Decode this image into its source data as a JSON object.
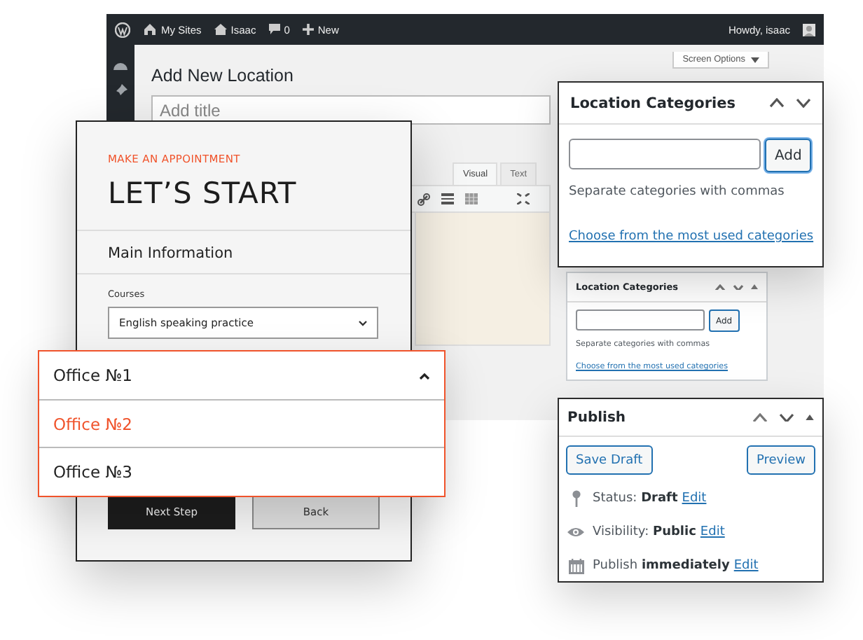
{
  "admin": {
    "toolbar": {
      "sites": "My Sites",
      "user_site": "Isaac",
      "comments": "0",
      "new": "New",
      "greeting": "Howdy, isaac"
    },
    "screen_options": "Screen Options",
    "page_title": "Add New Location",
    "title_field": {
      "placeholder": "Add title"
    },
    "editor_tabs": [
      {
        "label": "Visual",
        "selected": true
      },
      {
        "label": "Text",
        "selected": false
      }
    ],
    "side_box": {
      "title": "Location Categories",
      "button": "Add",
      "hint": "Separate categories with commas",
      "link": "Choose from the most used categories"
    }
  },
  "categories_panel": {
    "title": "Location Categories",
    "button": "Add",
    "hint": "Separate categories with commas",
    "link": "Choose from the most used categories"
  },
  "form": {
    "eyebrow": "MAKE AN APPOINTMENT",
    "title": "LET’S START",
    "section": "Main Information",
    "field_label": "Courses",
    "field_value": "English speaking practice",
    "buttons": [
      {
        "label": "Next Step",
        "kind": "primary"
      },
      {
        "label": "Back",
        "kind": "secondary"
      }
    ]
  },
  "office_dropdown": {
    "value": "Office №1",
    "expanded": true,
    "options": [
      {
        "label": "Office №2",
        "selected": true
      },
      {
        "label": "Office №3",
        "selected": false
      }
    ]
  },
  "publish": {
    "title": "Publish",
    "buttons": [
      "Save Draft",
      "Preview"
    ],
    "rows": [
      {
        "kind": "status",
        "text": "Status: **Draft**",
        "link": "Edit"
      },
      {
        "kind": "visibility",
        "text": "Visibility: **Public**",
        "link": "Edit"
      },
      {
        "kind": "schedule",
        "text": "Publish **immediately**",
        "link": "Edit"
      }
    ]
  }
}
